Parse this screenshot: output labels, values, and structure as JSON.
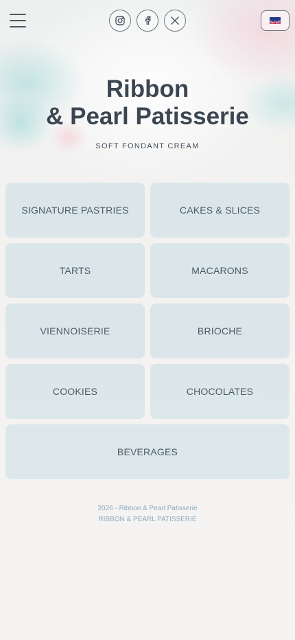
{
  "header": {
    "menu_icon": "hamburger-icon",
    "social": [
      {
        "name": "instagram",
        "icon": "instagram-icon"
      },
      {
        "name": "facebook",
        "icon": "facebook-icon"
      },
      {
        "name": "x",
        "icon": "x-icon"
      }
    ],
    "language_icon": "uk-flag-icon"
  },
  "hero": {
    "title_line1": "Ribbon",
    "title_line2": "& Pearl Patisserie",
    "subtitle": "SOFT FONDANT CREAM"
  },
  "categories": [
    {
      "label": "SIGNATURE PASTRIES"
    },
    {
      "label": "CAKES & SLICES"
    },
    {
      "label": "TARTS"
    },
    {
      "label": "MACARONS"
    },
    {
      "label": "VIENNOISERIE"
    },
    {
      "label": "BRIOCHE"
    },
    {
      "label": "COOKIES"
    },
    {
      "label": "CHOCOLATES"
    },
    {
      "label": "BEVERAGES"
    }
  ],
  "footer": {
    "line1": "2026 - Ribbon & Pearl Patisserie",
    "line2": "RIBBON & PEARL PATISSERIE"
  },
  "colors": {
    "card_bg": "#c6dce4",
    "text": "#3b4652",
    "footer_text": "#8aa9bf"
  }
}
